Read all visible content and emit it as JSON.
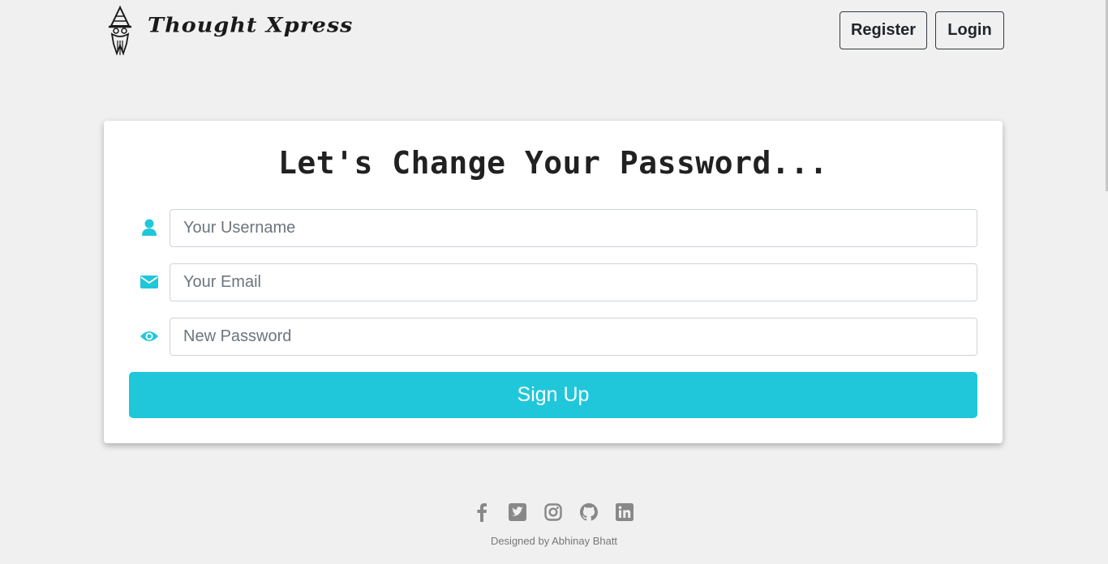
{
  "brand": {
    "name": "Thought Xpress",
    "logo_icon": "wizard-logo-icon"
  },
  "nav": {
    "register_label": "Register",
    "login_label": "Login"
  },
  "form": {
    "title": "Let's Change Your Password...",
    "username": {
      "placeholder": "Your Username",
      "value": "",
      "icon": "user-icon"
    },
    "email": {
      "placeholder": "Your Email",
      "value": "",
      "icon": "envelope-icon"
    },
    "password": {
      "placeholder": "New Password",
      "value": "",
      "icon": "eye-icon"
    },
    "submit_label": "Sign Up"
  },
  "footer": {
    "social": [
      "facebook-icon",
      "twitter-icon",
      "instagram-icon",
      "github-icon",
      "linkedin-icon"
    ],
    "credit": "Designed by Abhinay Bhatt"
  },
  "colors": {
    "accent": "#20c7db",
    "background": "#f0f0f0",
    "icon_gray": "#888888"
  }
}
